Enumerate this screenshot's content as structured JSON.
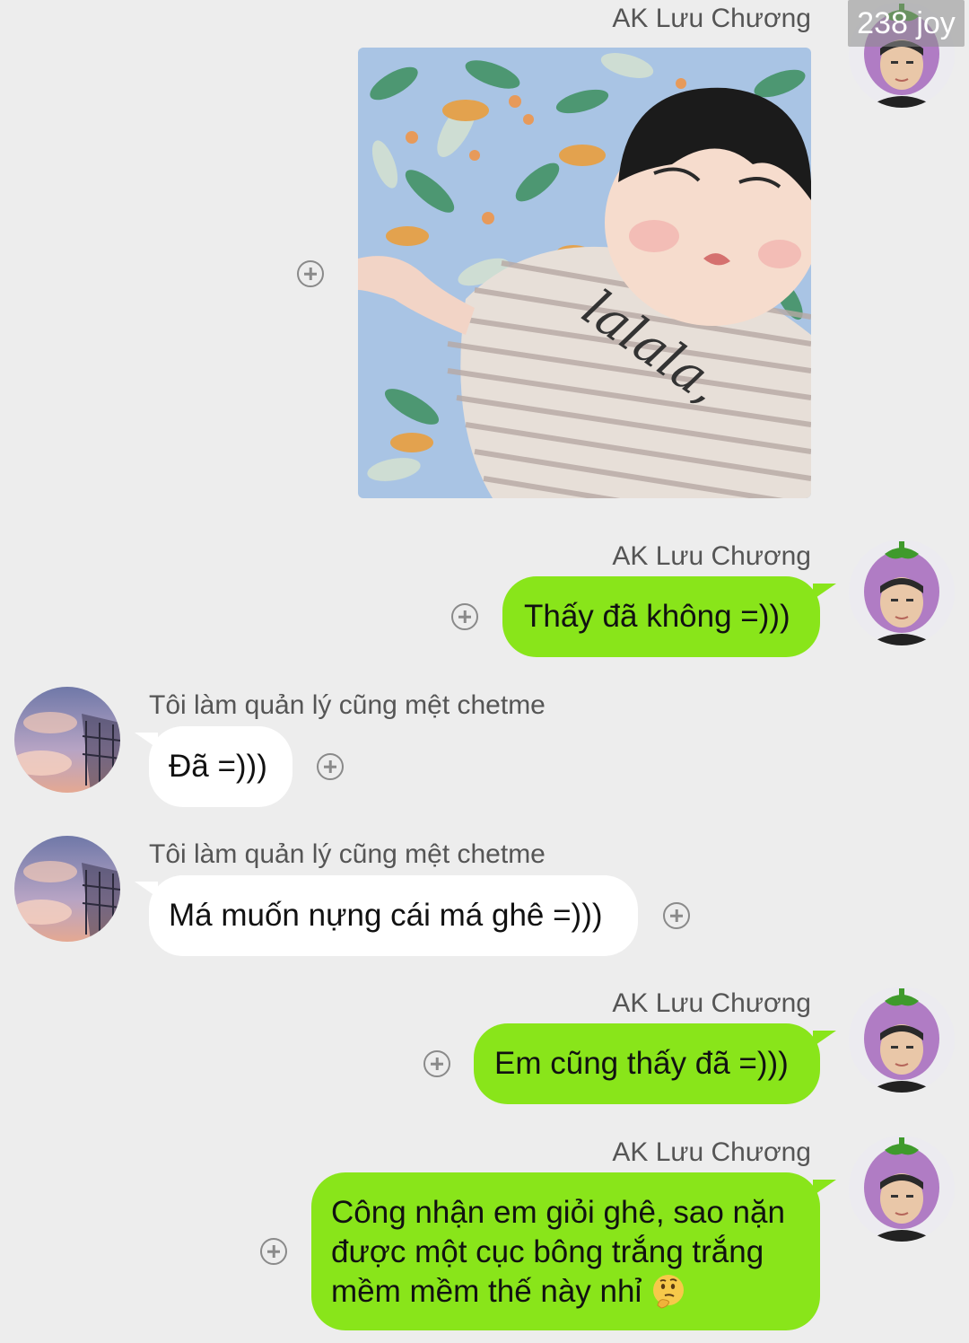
{
  "watermark": "238 joy",
  "chat": {
    "me_name": "AK Lưu Chương",
    "other_name": "Tôi làm quản lý cũng mệt chetme",
    "messages": [
      {
        "sender": "me",
        "type": "image",
        "image_caption_text": "lalala,"
      },
      {
        "sender": "me",
        "type": "text",
        "text": "Thấy đã không =)))"
      },
      {
        "sender": "other",
        "type": "text",
        "text": "Đã =)))"
      },
      {
        "sender": "other",
        "type": "text",
        "text": "Má muốn nựng cái má ghê =)))"
      },
      {
        "sender": "me",
        "type": "text",
        "text": "Em cũng thấy đã =)))"
      },
      {
        "sender": "me",
        "type": "text",
        "lines": [
          "Công nhận em giỏi ghê, sao nặn",
          "được một cục bông trắng trắng",
          "mềm mềm thế này nhỉ"
        ],
        "emoji": "thinking-face"
      }
    ]
  },
  "icons": {
    "add_reaction": "plus-circle-icon",
    "me_avatar": "eggplant-hat-avatar",
    "other_avatar": "sunset-sky-avatar"
  },
  "colors": {
    "background": "#ededed",
    "my_bubble": "#89e51a",
    "their_bubble": "#ffffff"
  }
}
